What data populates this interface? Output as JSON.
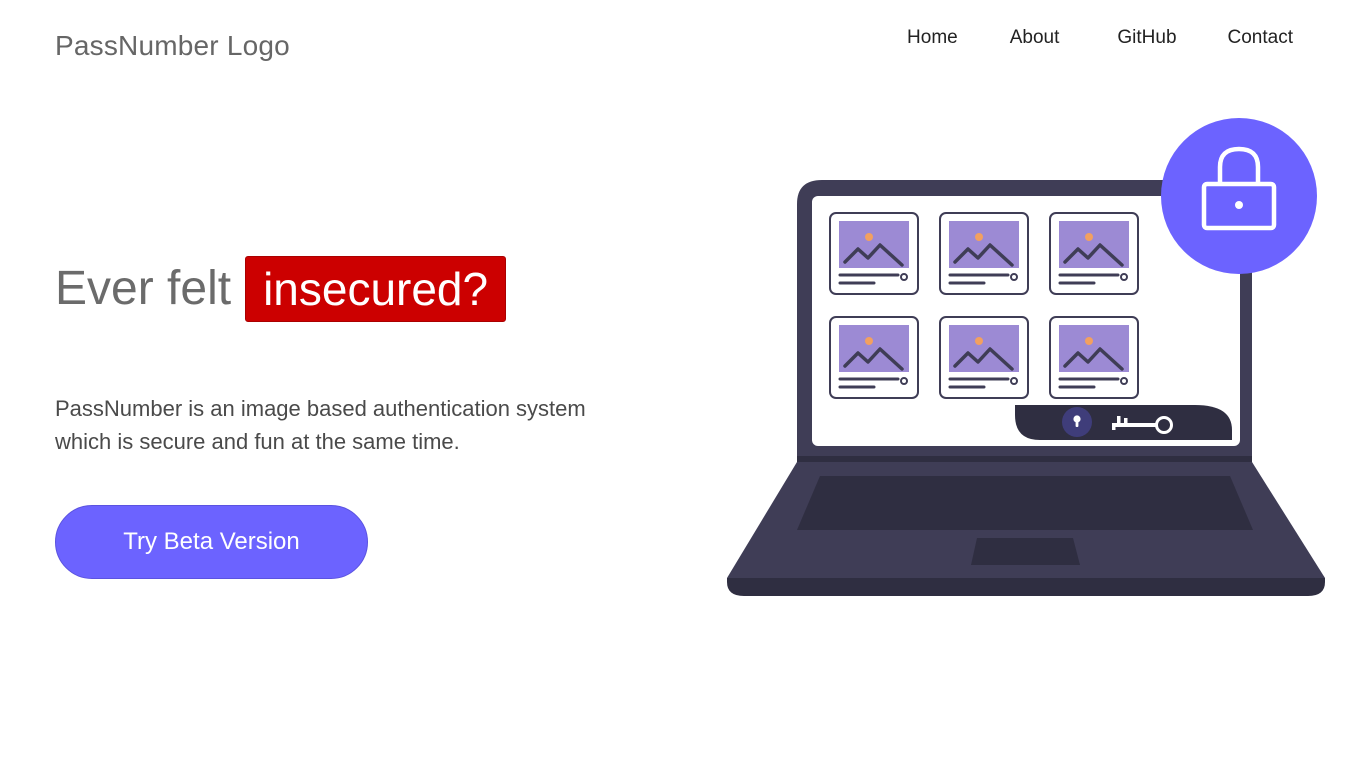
{
  "header": {
    "logo": "PassNumber Logo",
    "nav": [
      "Home",
      "About",
      "GitHub",
      "Contact"
    ]
  },
  "hero": {
    "headline_plain": "Ever felt",
    "headline_highlight": "insecured?",
    "description": "PassNumber is an image based authentication system which is secure and fun at the same time.",
    "cta_label": "Try Beta Version"
  },
  "illustration": {
    "icons": [
      "laptop-icon",
      "lock-icon",
      "image-icon",
      "keyhole-icon",
      "key-icon"
    ],
    "image_tile_count": 6
  },
  "colors": {
    "accent": "#6c63ff",
    "highlight": "#cc0000",
    "laptop": "#3f3d56",
    "laptop_dark": "#2f2e41",
    "tile_image": "#9c8ad4",
    "sun": "#f2a060"
  }
}
